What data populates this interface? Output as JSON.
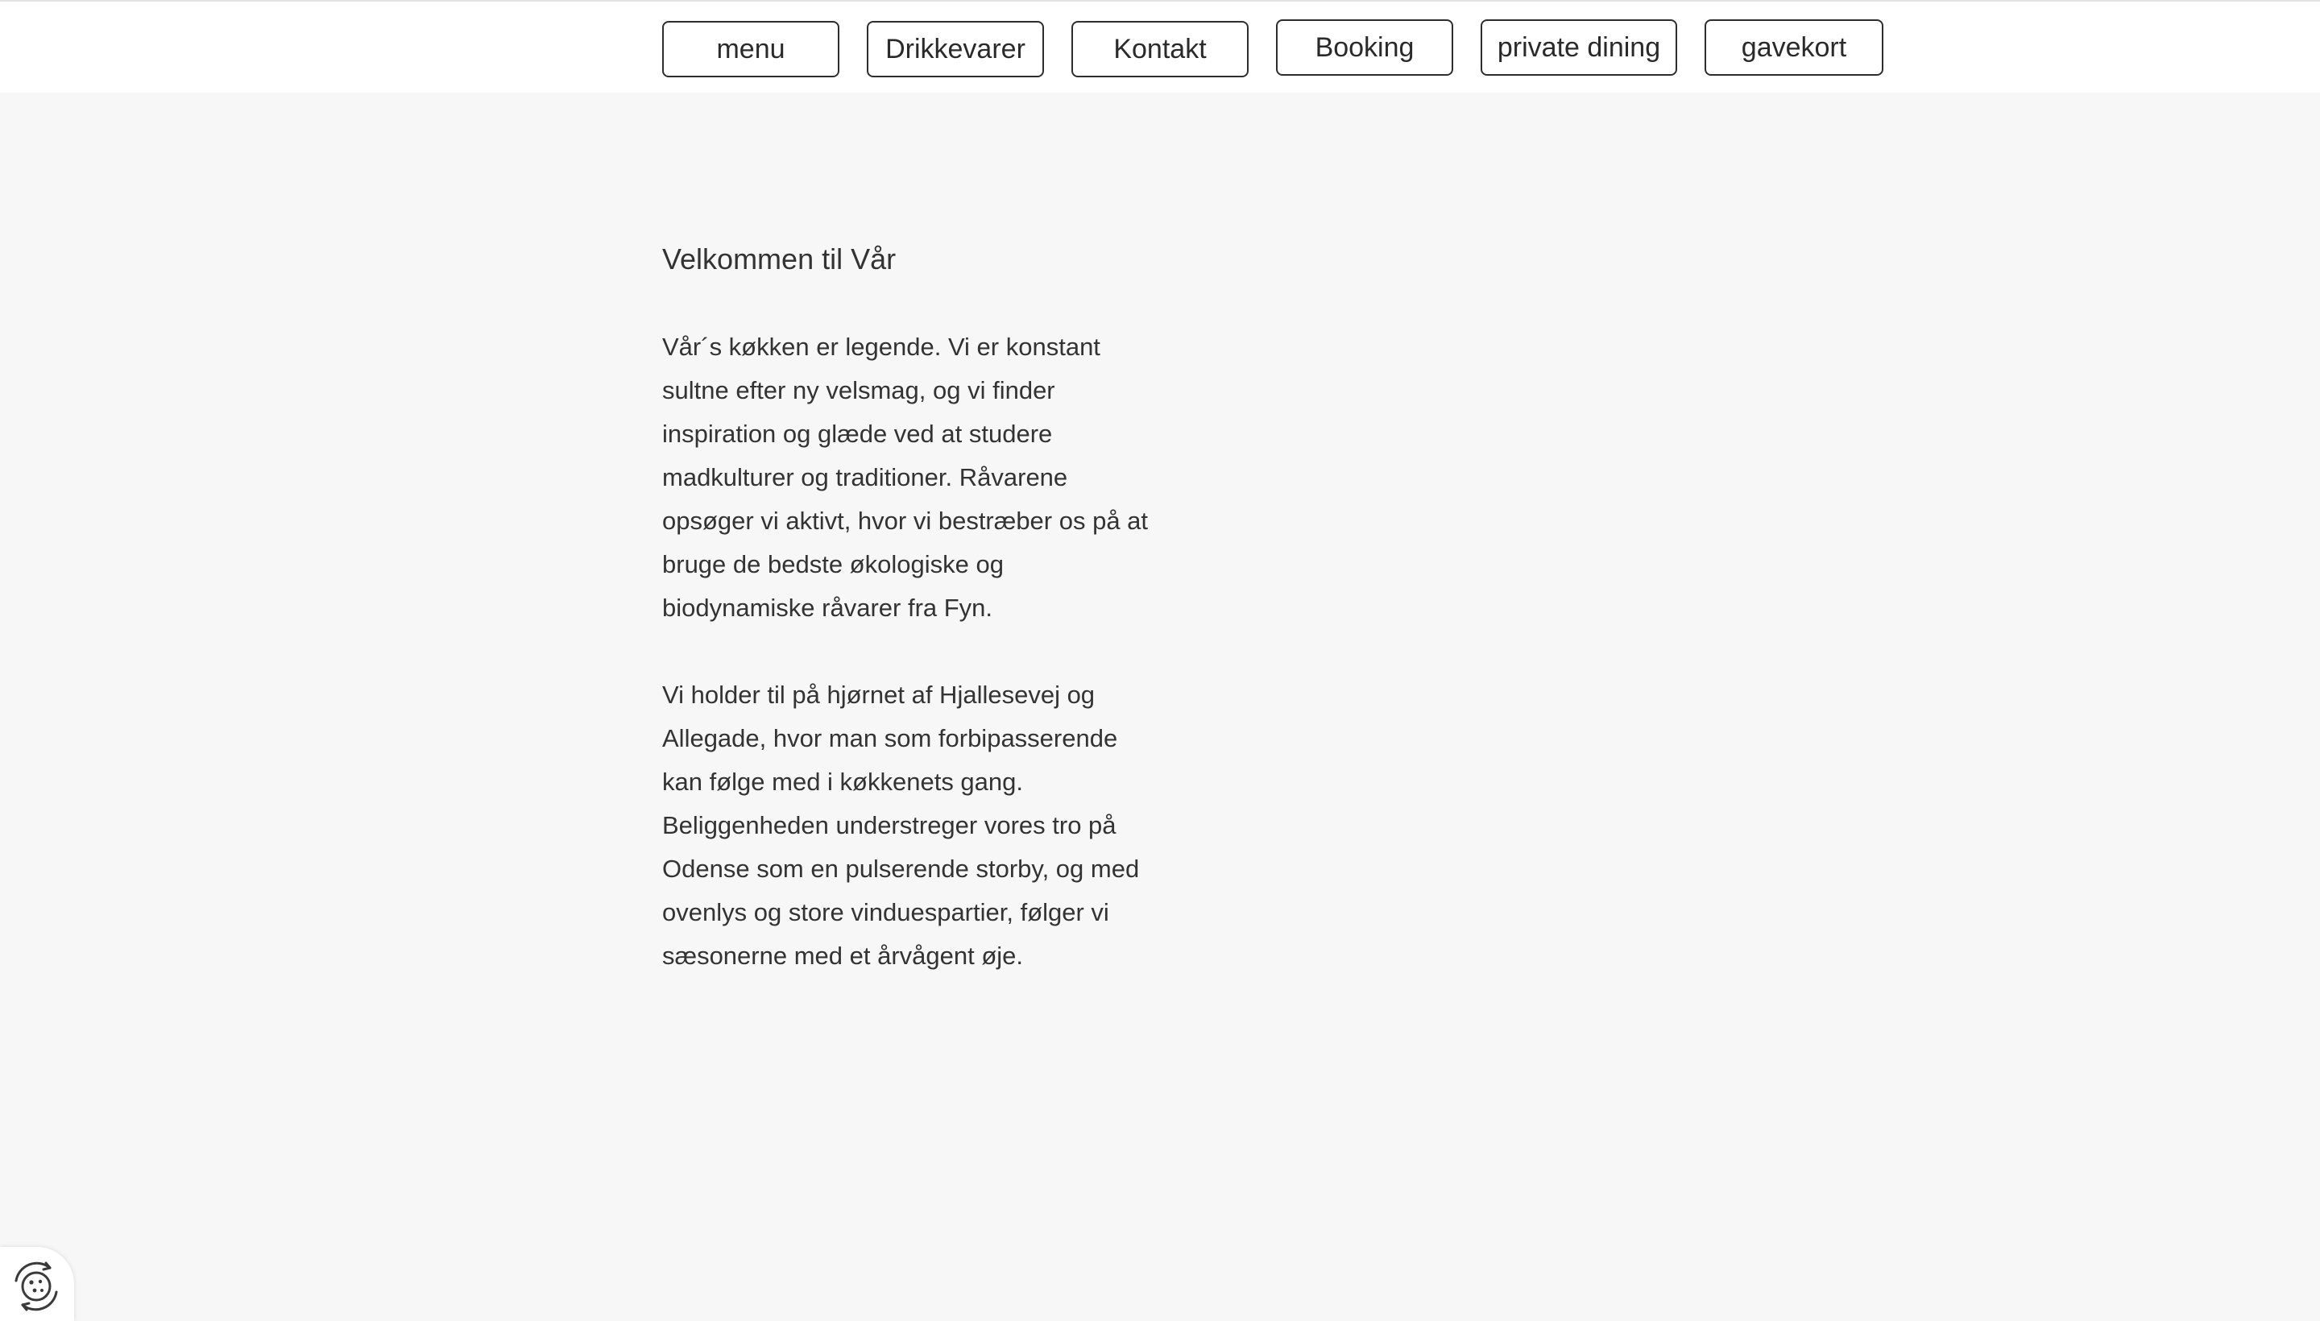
{
  "nav": {
    "items": [
      {
        "label": "menu"
      },
      {
        "label": "Drikkevarer"
      },
      {
        "label": "Kontakt"
      },
      {
        "label": "Booking"
      },
      {
        "label": "private dining"
      },
      {
        "label": "gavekort"
      }
    ]
  },
  "main": {
    "heading": "Velkommen til Vår",
    "paragraphs": [
      "Vår´s køkken er legende. Vi er konstant\nsultne efter ny velsmag, og vi finder\ninspiration og glæde ved at studere\nmadkulturer og traditioner. Råvarene\nopsøger vi aktivt, hvor vi bestræber os på at\nbruge de bedste økologiske og\nbiodynamiske råvarer fra Fyn.",
      "Vi holder til på hjørnet af Hjallesevej og\nAllegade, hvor man som forbipasserende\nkan følge  med i køkkenets gang.\nBeliggenheden understreger vores tro på\nOdense som en pulserende storby, og med\novenlys og  store vinduespartier, følger vi\nsæsonerne med et årvågent øje."
    ]
  },
  "cookie_widget": {
    "icon": "cookie-settings-icon"
  },
  "colors": {
    "page_background": "#f6f7f6",
    "header_background": "#ffffff",
    "button_border": "#2d2d2d",
    "text": "#333333"
  }
}
